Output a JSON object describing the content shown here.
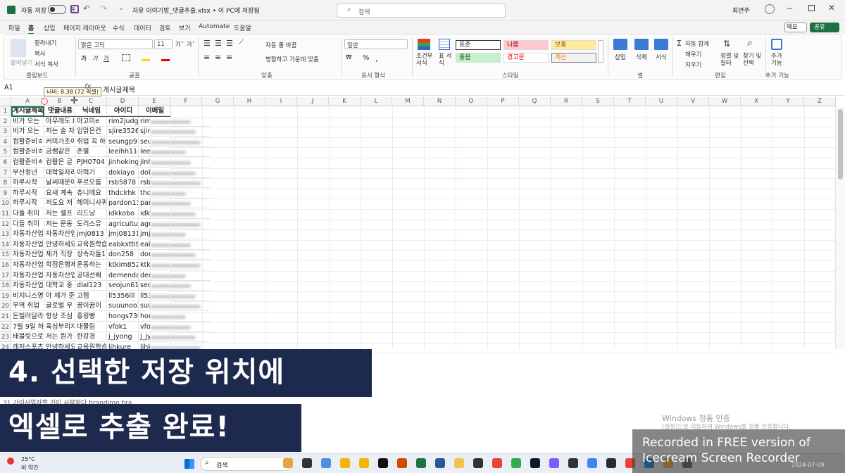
{
  "titlebar": {
    "autosave_label": "자동 저장",
    "toggle_state": "끔",
    "document_title": "자유 이야기방_댓글추출.xlsx • 이 PC에 저장됨",
    "search_placeholder": "검색",
    "user_name": "최연주"
  },
  "menu": [
    "파일",
    "홈",
    "삽입",
    "페이지 레이아웃",
    "수식",
    "데이터",
    "검토",
    "보기",
    "Automate",
    "도움말"
  ],
  "menu_active": "홈",
  "menu_right": {
    "memo": "메모",
    "share": "공유"
  },
  "ribbon": {
    "clipboard": {
      "paste": "붙여넣기",
      "cut": "잘라내기",
      "copy": "복사",
      "format_painter": "서식 복사",
      "label": "클립보드"
    },
    "font": {
      "name": "맑은 고딕",
      "size": "11",
      "label": "글꼴",
      "bold": "가",
      "italic": "가",
      "underline": "가"
    },
    "alignment": {
      "wrap": "자동 줄 바꿈",
      "merge": "병합하고 가운데 맞춤",
      "label": "맞춤"
    },
    "number": {
      "format": "일반",
      "label": "표시 형식"
    },
    "styles": {
      "conditional": "조건부 서식",
      "table": "표 서식",
      "cells": [
        "표준",
        "나쁨",
        "보통",
        "좋음",
        "경고문",
        "계산"
      ],
      "label": "스타일"
    },
    "cells": {
      "insert": "삽입",
      "delete": "삭제",
      "format": "서식",
      "label": "셀"
    },
    "editing": {
      "autosum": "자동 합계",
      "fill": "채우기",
      "clear": "지우기",
      "sort": "정렬 및 필터",
      "find": "찾기 및 선택",
      "label": "편집"
    },
    "addins": {
      "button": "추가 기능",
      "label": "추가 기능"
    }
  },
  "formula_bar": {
    "cell_ref": "A1",
    "tooltip": "너비: 8.38 (72 픽셀)",
    "fx": "fx",
    "content": "게시글제목"
  },
  "columns": [
    "A",
    "B",
    "C",
    "D",
    "E",
    "F",
    "G",
    "H",
    "I",
    "J",
    "K",
    "L",
    "M",
    "N",
    "O",
    "P",
    "Q",
    "R",
    "S",
    "T",
    "U",
    "V",
    "W",
    "X",
    "Y",
    "Z"
  ],
  "sheet": {
    "headers": [
      "게시글제목",
      "댓글내용",
      "닉네임",
      "아이디",
      "이메일"
    ],
    "rows": [
      [
        "비가 오는",
        "아무래도 l",
        "아고미e",
        "rim2judge",
        "rim"
      ],
      [
        "비가 오는",
        "저는 술 자",
        "입맑은칸",
        "sjire3526",
        "sjire"
      ],
      [
        "컴활준비ㅎ",
        "커미가조이",
        "취업 꼭 하",
        "seungp91(",
        "seun"
      ],
      [
        "컴활준비ㅎ",
        "금쌤같은",
        "존별",
        "leeihh110",
        "leeih"
      ],
      [
        "컴활준비ㅎ",
        "컴활은 글",
        "PJH0704",
        "jinhoking",
        "jinho"
      ],
      [
        "부산청년",
        "대학일자리",
        "이력기",
        "dokiayo",
        "dokia"
      ],
      [
        "하루시작",
        "날씨때문이",
        "푸르오름",
        "rsb5878",
        "rsb5"
      ],
      [
        "하루시작",
        "요새 계속",
        "츄니에요",
        "thdclrhk",
        "thdcl"
      ],
      [
        "하루시작",
        "저도요 저",
        "헤미니사퀴",
        "pardon13",
        "pard"
      ],
      [
        "다들 취미",
        "저는 셀프",
        "리드냥",
        "idkkobo",
        "idkk"
      ],
      [
        "다들 취미",
        "저는 운동",
        "도리스유",
        "agriculture",
        "agri"
      ],
      [
        "자동차산업",
        "자동차산업",
        "jmj0813",
        "jmj081313",
        "jmj"
      ],
      [
        "자동차산업",
        "안녕하세요",
        "교육원학습",
        "eabkxttitn",
        "eabk"
      ],
      [
        "자동차산업",
        "제가 직장",
        "상속자들1",
        "don258",
        "don2"
      ],
      [
        "자동차산업",
        "학점은행제",
        "운동하는",
        "ktkim852",
        "ktki"
      ],
      [
        "자동차산업",
        "자동차산업",
        "공대선배",
        "demendar",
        "deme"
      ],
      [
        "자동차산업",
        "대학교 중",
        "dlal123",
        "seojun617",
        "seoj"
      ],
      [
        "비지니스영",
        "아 제가 준",
        "고젬",
        "ll5356lll",
        "ll53"
      ],
      [
        "무역 취업",
        "글로벌 무",
        "꿈이꿈이",
        "suuunoo2",
        "suuu"
      ],
      [
        "돈빌려달라",
        "항상 조심",
        "홍윙빵",
        "hongs730",
        "hong"
      ],
      [
        "7월 9일 하",
        "육심부리지",
        "대물림",
        "vfok1",
        "vfok"
      ],
      [
        "태블릿으로",
        "저는 뭔가",
        "한강경",
        "j_jyong",
        "j_jyo"
      ],
      [
        "레저스포츠",
        "안녕하세요",
        "교육원학습",
        "ljhkure",
        "ljhku"
      ],
      [
        "레저스포츠",
        "레저스포츠",
        "내일은희망",
        "gusdl523",
        "gusd"
      ]
    ],
    "row31": "31 가이사업자할 가이 사람하다 brandiroo bra"
  },
  "banner": {
    "line1": "4. 선택한 저장 위치에",
    "line2": "엑셀로 추출 완료!"
  },
  "activation": {
    "title": "Windows 정품 인증",
    "subtitle": "[설정]으로 이동하여 Windows를 정품 인증합니다."
  },
  "watermark": "Recorded in FREE version of Icecream Screen Recorder",
  "taskbar": {
    "temp": "25°C",
    "weather": "비 약간",
    "search": "검색",
    "date": "2024-07-09"
  },
  "colors": {
    "excel_green": "#1e7145",
    "banner": "#1d2a4d",
    "bad": "#ffc7ce",
    "neutral": "#ffeb9c",
    "good": "#c6efce"
  }
}
